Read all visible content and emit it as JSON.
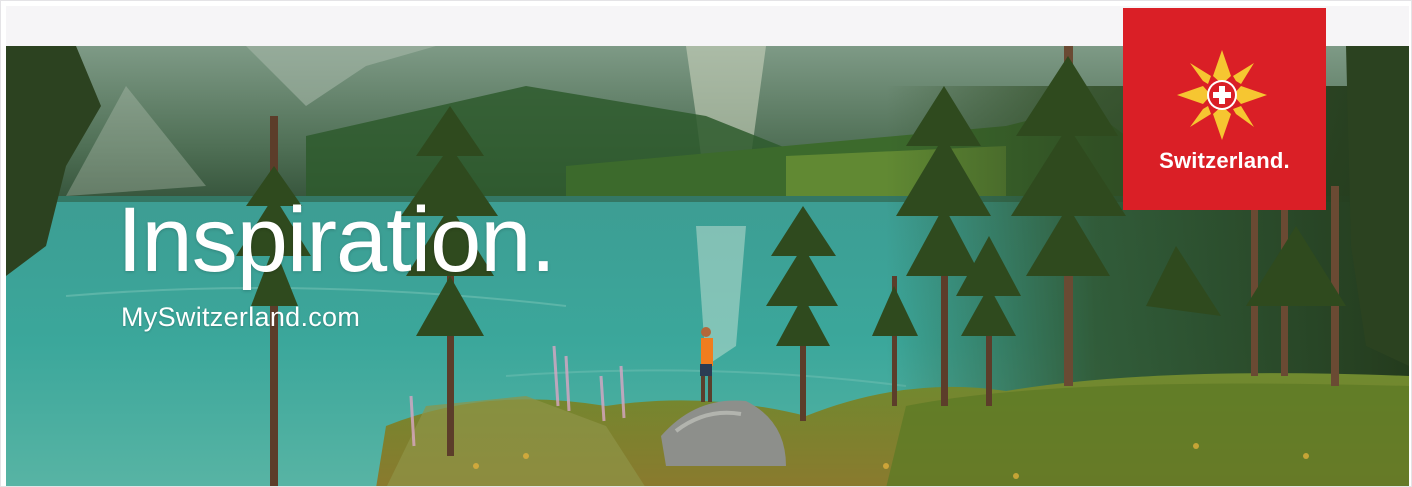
{
  "banner": {
    "headline": "Inspiration.",
    "url_text": "MySwitzerland.com",
    "image_subject": "hiker-at-alpine-lake-photo"
  },
  "logo": {
    "text": "Switzerland.",
    "background_color": "#da1f26",
    "mark_color": "#f6c631",
    "icon": "swiss-flower-cross-icon"
  }
}
